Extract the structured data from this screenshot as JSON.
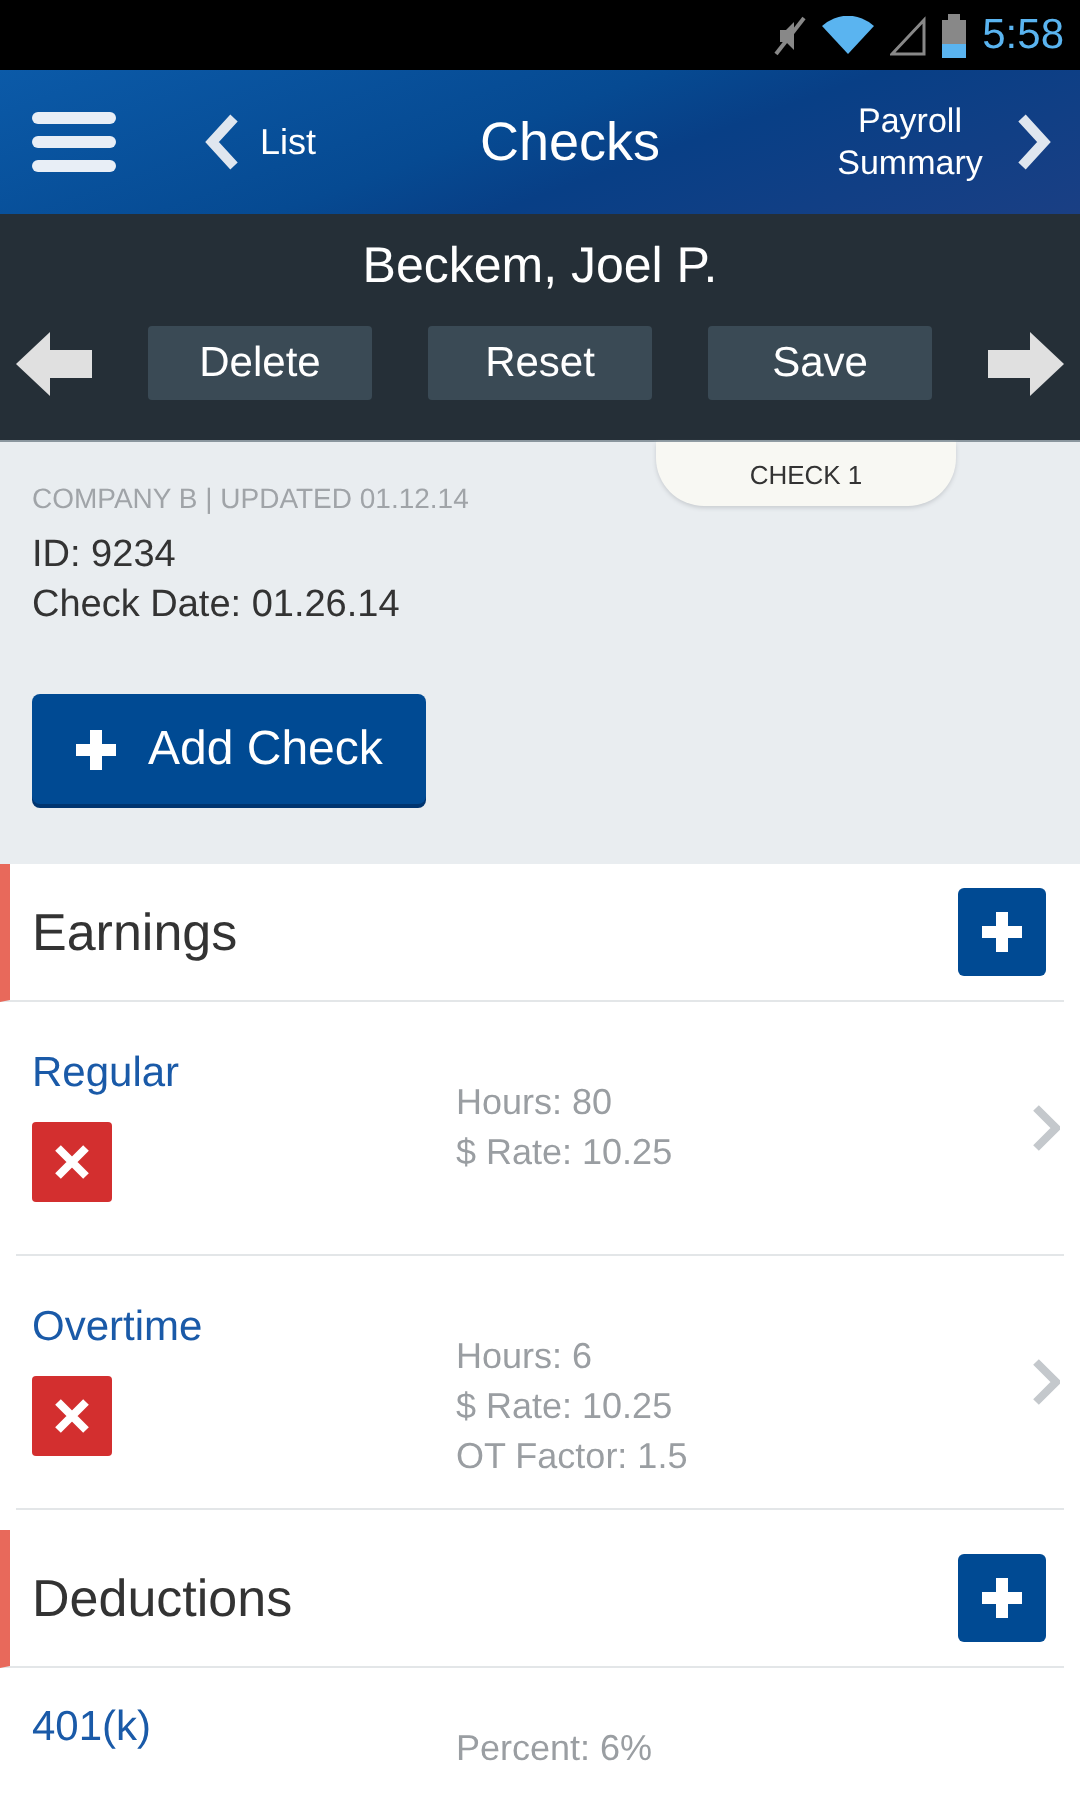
{
  "status_bar": {
    "time": "5:58"
  },
  "header": {
    "back": "List",
    "title": "Checks",
    "forward": "Payroll Summary"
  },
  "employee": {
    "name": "Beckem, Joel P.",
    "actions": [
      "Delete",
      "Reset",
      "Save"
    ]
  },
  "check": {
    "tab": "CHECK 1",
    "meta": "COMPANY B | UPDATED 01.12.14",
    "id": "ID: 9234",
    "date": "Check Date: 01.26.14",
    "add_button": "Add Check"
  },
  "sections": [
    {
      "title": "Earnings",
      "items": [
        {
          "name": "Regular",
          "details": [
            "Hours: 80",
            "$ Rate: 10.25"
          ],
          "cut": false
        },
        {
          "name": "Overtime",
          "details": [
            "Hours: 6",
            "$ Rate: 10.25",
            "OT Factor: 1.5"
          ],
          "cut": false
        }
      ]
    },
    {
      "title": "Deductions",
      "items": [
        {
          "name": "401(k)",
          "details": [
            "Percent: 6%"
          ],
          "cut": true
        }
      ]
    }
  ]
}
